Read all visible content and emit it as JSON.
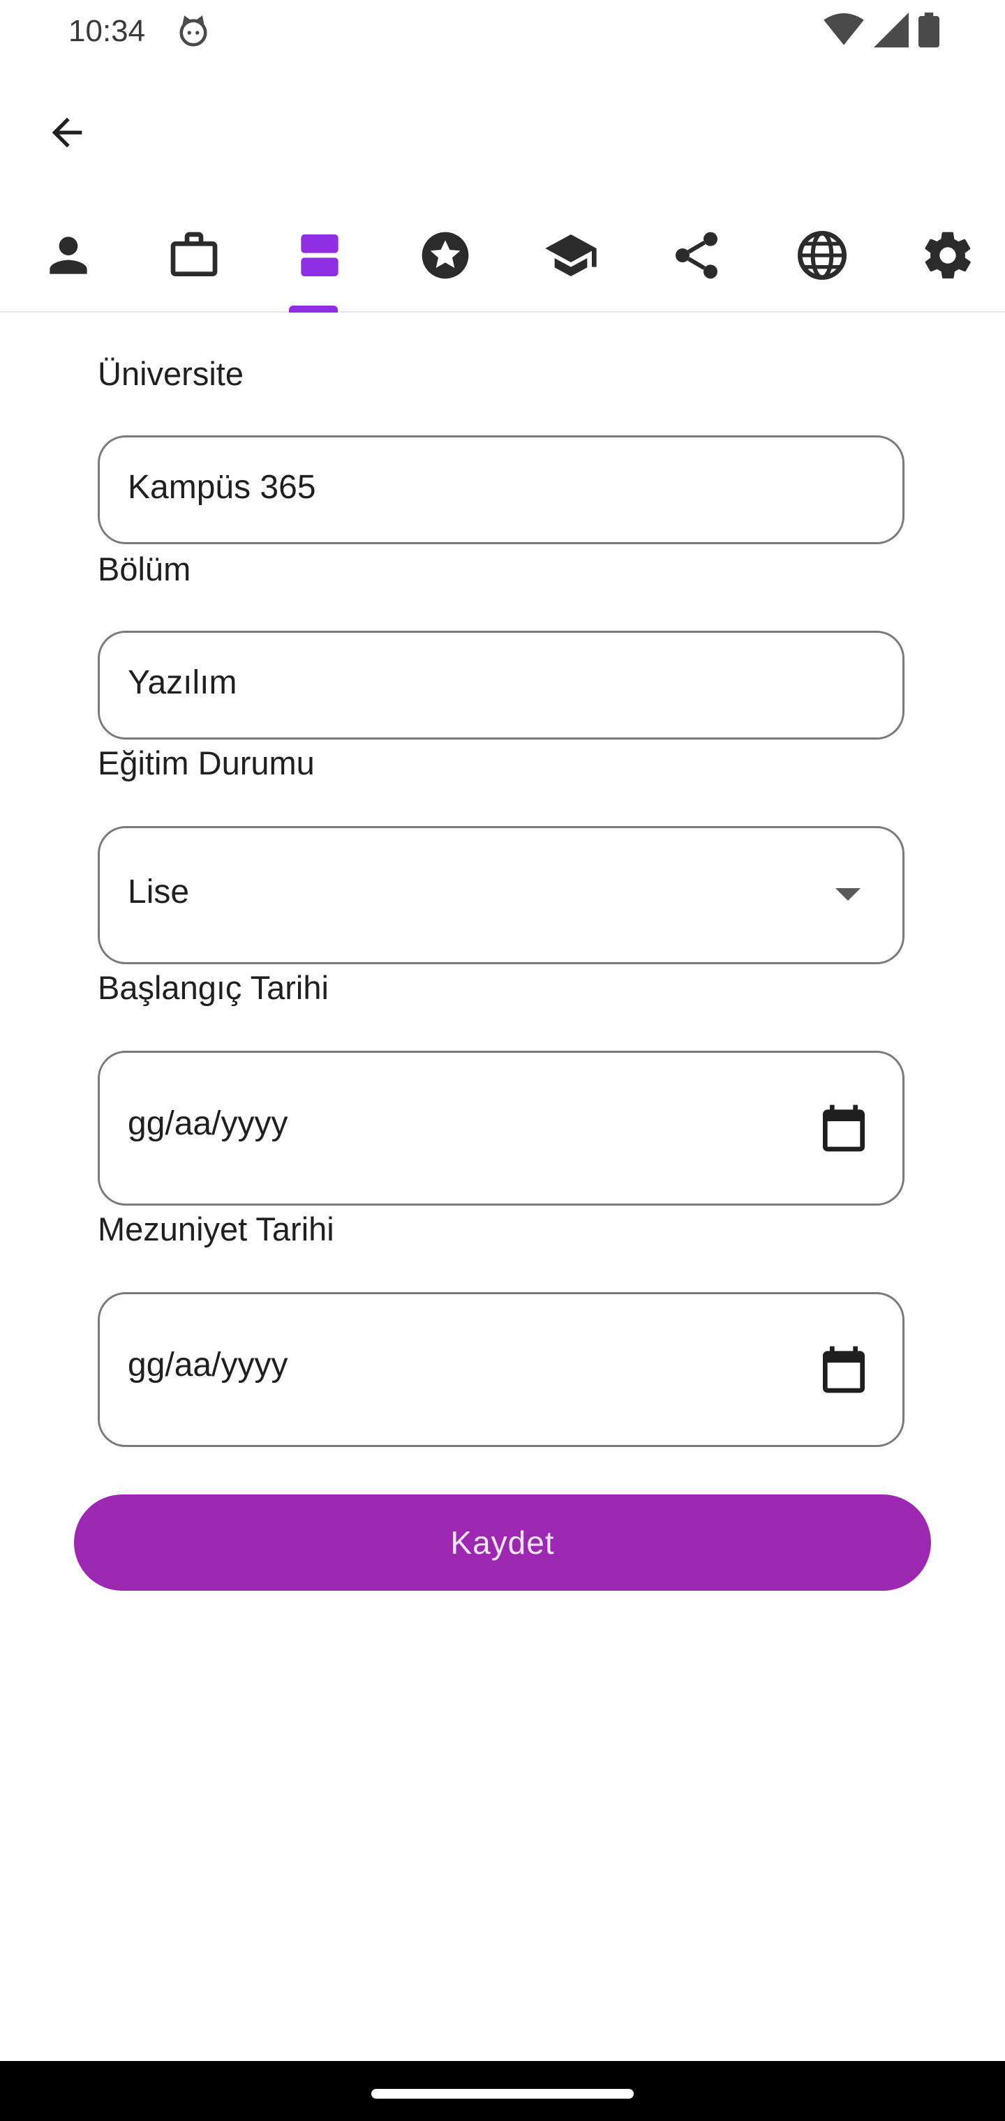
{
  "status_bar": {
    "time": "10:34",
    "icons": [
      "android-cat-icon",
      "wifi-icon",
      "signal-icon",
      "battery-icon"
    ]
  },
  "app_bar": {
    "back_icon": "arrow-back-icon"
  },
  "tabs": {
    "items": [
      {
        "icon": "person-icon"
      },
      {
        "icon": "briefcase-icon"
      },
      {
        "icon": "education-list-icon"
      },
      {
        "icon": "star-badge-icon"
      },
      {
        "icon": "graduation-cap-icon"
      },
      {
        "icon": "share-icon"
      },
      {
        "icon": "globe-icon"
      },
      {
        "icon": "settings-icon"
      }
    ],
    "selected_index": 2,
    "accent_color": "#8e2de2"
  },
  "form": {
    "university": {
      "label": "Üniversite",
      "value": "Kampüs 365"
    },
    "department": {
      "label": "Bölüm",
      "value": "Yazılım"
    },
    "education_status": {
      "label": "Eğitim Durumu",
      "selected": "Lise"
    },
    "start_date": {
      "label": "Başlangıç Tarihi",
      "placeholder": "gg/aa/yyyy"
    },
    "graduation_date": {
      "label": "Mezuniyet Tarihi",
      "placeholder": "gg/aa/yyyy"
    }
  },
  "save_button": {
    "label": "Kaydet",
    "color": "#9c27b0"
  }
}
